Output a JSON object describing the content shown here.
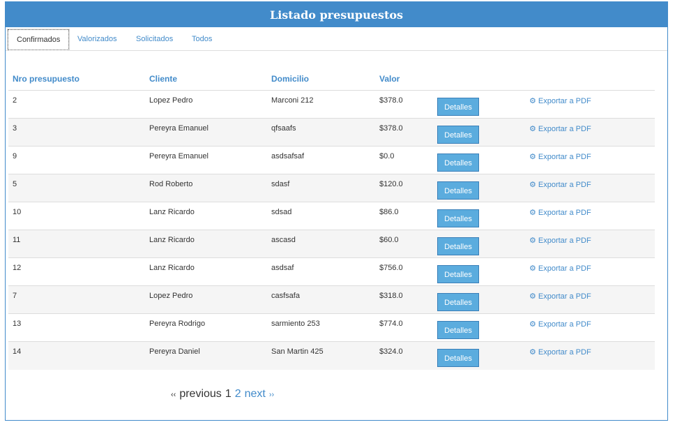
{
  "header": {
    "title": "Listado presupuestos"
  },
  "tabs": [
    {
      "label": "Confirmados",
      "active": true
    },
    {
      "label": "Valorizados"
    },
    {
      "label": "Solicitados"
    },
    {
      "label": "Todos"
    }
  ],
  "table": {
    "columns": [
      "Nro presupuesto",
      "Cliente",
      "Domicilio",
      "Valor"
    ],
    "details_label": "Detalles",
    "export_label": "Exportar a PDF",
    "rows": [
      {
        "nro": "2",
        "cliente": "Lopez Pedro",
        "domicilio": "Marconi 212",
        "valor": "$378.0"
      },
      {
        "nro": "3",
        "cliente": "Pereyra Emanuel",
        "domicilio": "qfsaafs",
        "valor": "$378.0"
      },
      {
        "nro": "9",
        "cliente": "Pereyra Emanuel",
        "domicilio": "asdsafsaf",
        "valor": "$0.0"
      },
      {
        "nro": "5",
        "cliente": "Rod Roberto",
        "domicilio": "sdasf",
        "valor": "$120.0"
      },
      {
        "nro": "10",
        "cliente": "Lanz Ricardo",
        "domicilio": "sdsad",
        "valor": "$86.0"
      },
      {
        "nro": "11",
        "cliente": "Lanz Ricardo",
        "domicilio": "ascasd",
        "valor": "$60.0"
      },
      {
        "nro": "12",
        "cliente": "Lanz Ricardo",
        "domicilio": "asdsaf",
        "valor": "$756.0"
      },
      {
        "nro": "7",
        "cliente": "Lopez Pedro",
        "domicilio": "casfsafa",
        "valor": "$318.0"
      },
      {
        "nro": "13",
        "cliente": "Pereyra Rodrigo",
        "domicilio": "sarmiento 253",
        "valor": "$774.0"
      },
      {
        "nro": "14",
        "cliente": "Pereyra Daniel",
        "domicilio": "San Martin 425",
        "valor": "$324.0"
      }
    ]
  },
  "pagination": {
    "prev_arrow": "‹‹",
    "previous": "previous",
    "current": "1",
    "page2": "2",
    "next": "next",
    "next_arrow": "››"
  },
  "icons": {
    "export": "gear-icon"
  },
  "colors": {
    "primary": "#428bca",
    "button": "#5bacde"
  }
}
